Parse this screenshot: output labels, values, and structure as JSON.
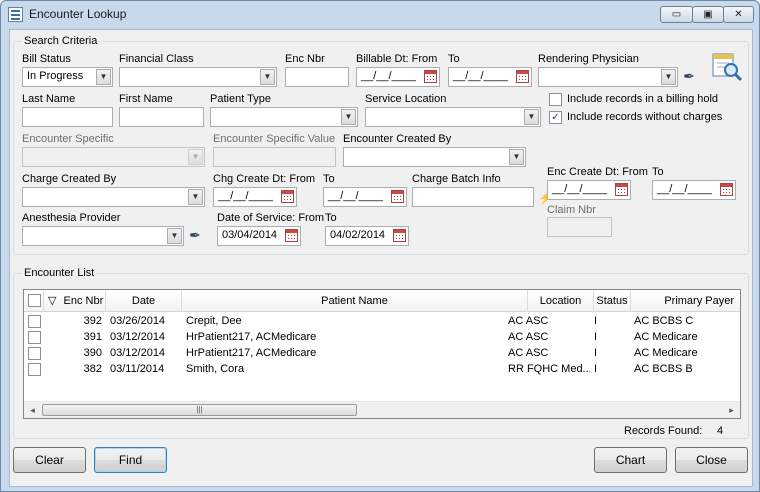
{
  "window": {
    "title": "Encounter Lookup",
    "min_glyph": "▭",
    "max_glyph": "▣",
    "close_glyph": "✕"
  },
  "search_criteria": {
    "group_title": "Search Criteria",
    "bill_status": {
      "label": "Bill Status",
      "value": "In Progress"
    },
    "financial_class": {
      "label": "Financial Class",
      "value": ""
    },
    "enc_nbr": {
      "label": "Enc Nbr",
      "value": ""
    },
    "billable_dt": {
      "label_from": "Billable Dt:  From",
      "label_to": "To",
      "from_value": "__/__/____",
      "to_value": "__/__/____"
    },
    "rendering_physician": {
      "label": "Rendering Physician",
      "value": ""
    },
    "last_name": {
      "label": "Last Name",
      "value": ""
    },
    "first_name": {
      "label": "First Name",
      "value": ""
    },
    "patient_type": {
      "label": "Patient Type",
      "value": ""
    },
    "service_location": {
      "label": "Service Location",
      "value": ""
    },
    "include_billing_hold": {
      "label": "Include records in a billing hold",
      "checked": false
    },
    "include_without_charges": {
      "label": "Include records without charges",
      "checked": true
    },
    "encounter_specific": {
      "label": "Encounter Specific",
      "value": ""
    },
    "encounter_specific_value": {
      "label": "Encounter Specific Value",
      "value": ""
    },
    "encounter_created_by": {
      "label": "Encounter Created By",
      "value": ""
    },
    "charge_created_by": {
      "label": "Charge Created By",
      "value": ""
    },
    "chg_create_dt": {
      "label_from": "Chg Create Dt: From",
      "label_to": "To",
      "from_value": "__/__/____",
      "to_value": "__/__/____"
    },
    "charge_batch_info": {
      "label": "Charge Batch Info",
      "value": ""
    },
    "enc_create_dt": {
      "label_from": "Enc Create Dt: From",
      "label_to": "To",
      "from_value": "__/__/____",
      "to_value": "__/__/____"
    },
    "claim_nbr": {
      "label": "Claim Nbr",
      "value": ""
    },
    "anesthesia_provider": {
      "label": "Anesthesia Provider",
      "value": ""
    },
    "date_of_service": {
      "label_from": "Date of Service: From",
      "label_to": "To",
      "from_value": "03/04/2014",
      "to_value": "04/02/2014"
    }
  },
  "encounter_list": {
    "group_title": "Encounter List",
    "columns": {
      "sort_glyph": "▽",
      "enc_nbr": "Enc Nbr",
      "date": "Date",
      "patient_name": "Patient Name",
      "location": "Location",
      "status": "Status",
      "primary_payer": "Primary Payer"
    },
    "rows": [
      {
        "enc_nbr": "392",
        "date": "03/26/2014",
        "patient_name": "Crepit, Dee",
        "location": "AC ASC",
        "status": "I",
        "primary_payer": "AC BCBS C"
      },
      {
        "enc_nbr": "391",
        "date": "03/12/2014",
        "patient_name": "HrPatient217, ACMedicare",
        "location": "AC ASC",
        "status": "I",
        "primary_payer": "AC Medicare"
      },
      {
        "enc_nbr": "390",
        "date": "03/12/2014",
        "patient_name": "HrPatient217, ACMedicare",
        "location": "AC ASC",
        "status": "I",
        "primary_payer": "AC Medicare"
      },
      {
        "enc_nbr": "382",
        "date": "03/11/2014",
        "patient_name": "Smith, Cora",
        "location": "RR FQHC Med...",
        "status": "I",
        "primary_payer": "AC BCBS B"
      }
    ],
    "scroll_left": "◂",
    "scroll_right": "▸",
    "scroll_grip": "|||"
  },
  "records_found": {
    "label": "Records Found:",
    "value": "4"
  },
  "buttons": {
    "clear": "Clear",
    "find": "Find",
    "chart": "Chart",
    "close": "Close"
  },
  "icons": {
    "arrow": "▼",
    "picker": "✒",
    "check": "✓",
    "lightning": "⚡"
  }
}
